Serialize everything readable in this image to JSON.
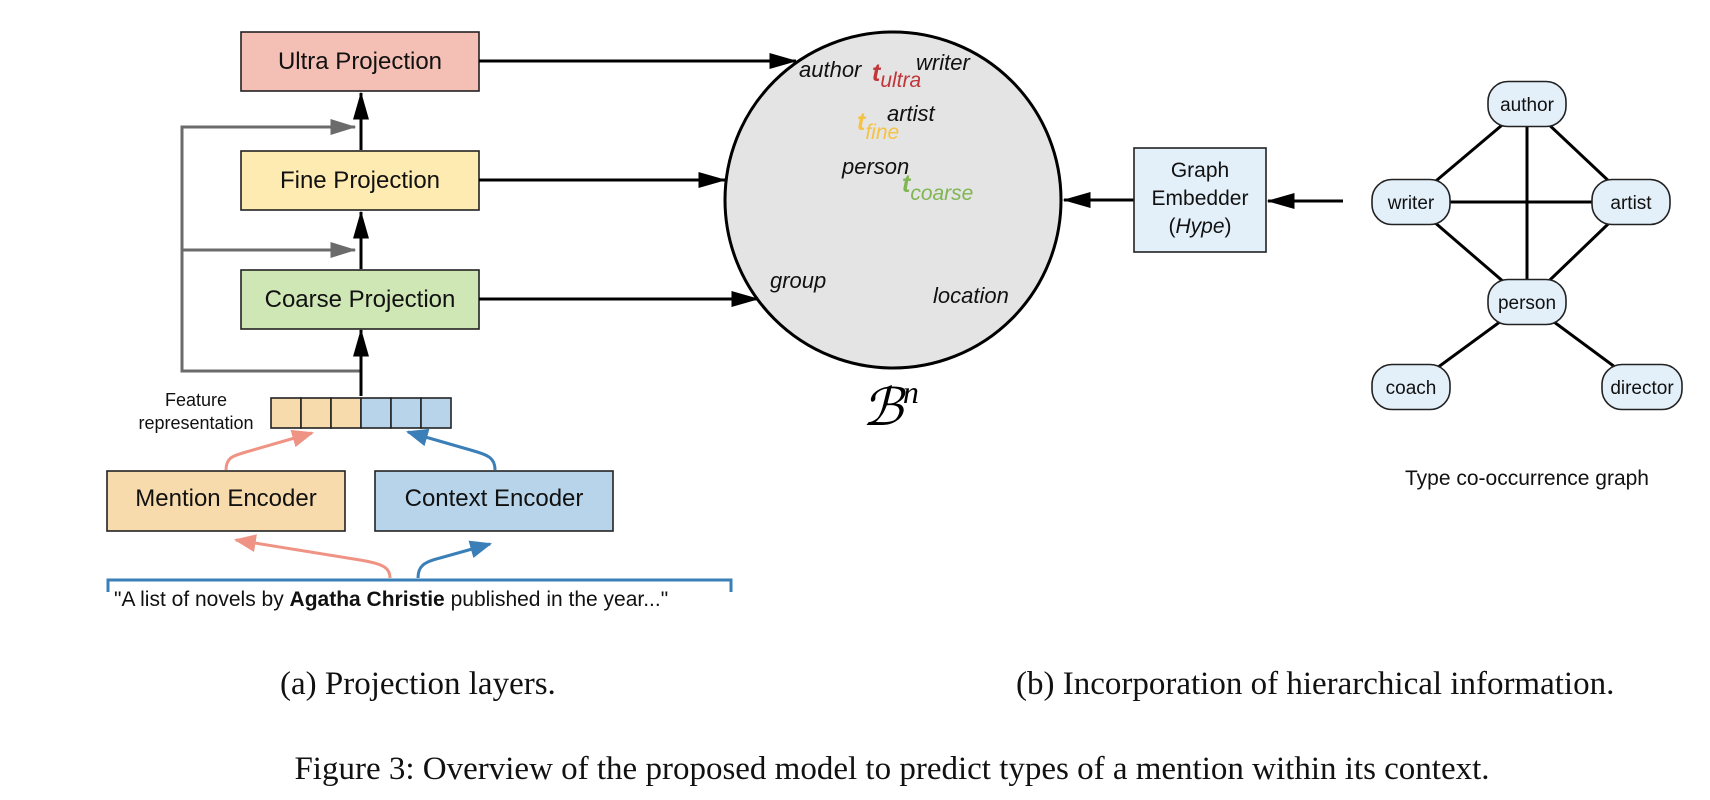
{
  "panel_a": {
    "boxes": {
      "ultra": {
        "label": "Ultra Projection",
        "color": "#f4bfb5"
      },
      "fine": {
        "label": "Fine Projection",
        "color": "#fdebb1"
      },
      "coarse": {
        "label": "Coarse Projection",
        "color": "#cfe6b5"
      },
      "mention": {
        "label": "Mention Encoder",
        "color": "#f8dbad"
      },
      "context": {
        "label": "Context Encoder",
        "color": "#b8d4ea"
      }
    },
    "feature_label_line1": "Feature",
    "feature_label_line2": "representation",
    "feature_cells": {
      "mention_count": 3,
      "context_count": 3
    },
    "input_sentence": {
      "before": "\"A list of novels by ",
      "mention": "Agatha Christie",
      "after": " published in the year...\""
    },
    "colors": {
      "mention_arrow": "#ef9484",
      "context_arrow": "#3a7fb8",
      "skip_arrow": "#6b6b6b",
      "bracket": "#3a7fb8"
    },
    "caption": "(a)  Projection layers."
  },
  "ball": {
    "symbol": "ℬ",
    "superscript": "n",
    "fill": "#e4e4e4",
    "words": {
      "author": "author",
      "writer": "writer",
      "artist": "artist",
      "person": "person",
      "group": "group",
      "location": "location"
    },
    "targets": {
      "ultra": {
        "t": "t",
        "sub": "ultra",
        "color": "#c0363a"
      },
      "fine": {
        "t": "t",
        "sub": "fine",
        "color": "#f5c243"
      },
      "coarse": {
        "t": "t",
        "sub": "coarse",
        "color": "#7fb552"
      }
    }
  },
  "panel_b": {
    "embedder": {
      "line1": "Graph",
      "line2": "Embedder",
      "line3_open": "(",
      "line3_name": "Hype",
      "line3_close": ")",
      "color": "#e3f0fa"
    },
    "graph": {
      "title": "Type co-occurrence graph",
      "node_color": "#e3f0fa",
      "nodes": {
        "author": "author",
        "writer": "writer",
        "artist": "artist",
        "person": "person",
        "coach": "coach",
        "director": "director"
      },
      "edges": [
        [
          "author",
          "writer"
        ],
        [
          "author",
          "artist"
        ],
        [
          "author",
          "person"
        ],
        [
          "writer",
          "artist"
        ],
        [
          "writer",
          "person"
        ],
        [
          "artist",
          "person"
        ],
        [
          "person",
          "coach"
        ],
        [
          "person",
          "director"
        ]
      ]
    },
    "caption": "(b)  Incorporation of hierarchical information."
  },
  "figure_caption": "Figure 3: Overview of the proposed model to predict types of a mention within its context."
}
